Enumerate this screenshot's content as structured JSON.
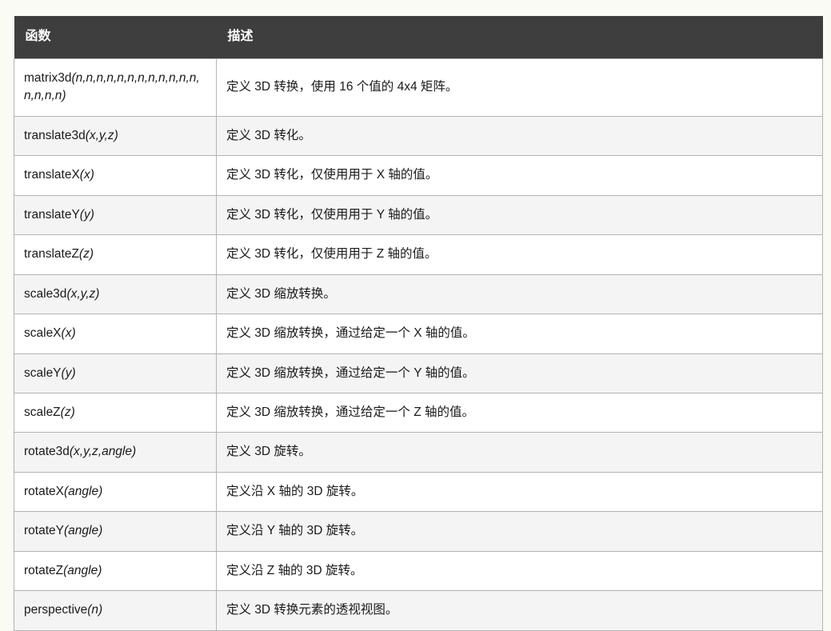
{
  "table": {
    "headers": {
      "function": "函数",
      "description": "描述"
    },
    "rows": [
      {
        "function_name": "matrix3d",
        "function_args": "(n,n,n,n,n,n,n,n,n,n,n,n,n,n,n,n)",
        "function_full": "matrix3d(n,n,n,n,n,n,n,n,n,n,n,n,n,n,n,n)",
        "description": "定义 3D 转换，使用 16 个值的 4x4 矩阵。"
      },
      {
        "function_name": "translate3d",
        "function_args": "(x,y,z)",
        "function_full": "translate3d(x,y,z)",
        "description": "定义 3D 转化。"
      },
      {
        "function_name": "translateX",
        "function_args": "(x)",
        "function_full": "translateX(x)",
        "description": "定义 3D 转化，仅使用用于 X 轴的值。"
      },
      {
        "function_name": "translateY",
        "function_args": "(y)",
        "function_full": "translateY(y)",
        "description": "定义 3D 转化，仅使用用于 Y 轴的值。"
      },
      {
        "function_name": "translateZ",
        "function_args": "(z)",
        "function_full": "translateZ(z)",
        "description": "定义 3D 转化，仅使用用于 Z 轴的值。"
      },
      {
        "function_name": "scale3d",
        "function_args": "(x,y,z)",
        "function_full": "scale3d(x,y,z)",
        "description": "定义 3D 缩放转换。"
      },
      {
        "function_name": "scaleX",
        "function_args": "(x)",
        "function_full": "scaleX(x)",
        "description": "定义 3D 缩放转换，通过给定一个 X 轴的值。"
      },
      {
        "function_name": "scaleY",
        "function_args": "(y)",
        "function_full": "scaleY(y)",
        "description": "定义 3D 缩放转换，通过给定一个 Y 轴的值。"
      },
      {
        "function_name": "scaleZ",
        "function_args": "(z)",
        "function_full": "scaleZ(z)",
        "description": "定义 3D 缩放转换，通过给定一个 Z 轴的值。"
      },
      {
        "function_name": "rotate3d",
        "function_args": "(x,y,z,angle)",
        "function_full": "rotate3d(x,y,z,angle)",
        "description": "定义 3D 旋转。"
      },
      {
        "function_name": "rotateX",
        "function_args": "(angle)",
        "function_full": "rotateX(angle)",
        "description": "定义沿 X 轴的 3D 旋转。"
      },
      {
        "function_name": "rotateY",
        "function_args": "(angle)",
        "function_full": "rotateY(angle)",
        "description": "定义沿 Y 轴的 3D 旋转。"
      },
      {
        "function_name": "rotateZ",
        "function_args": "(angle)",
        "function_full": "rotateZ(angle)",
        "description": "定义沿 Z 轴的 3D 旋转。"
      },
      {
        "function_name": "perspective",
        "function_args": "(n)",
        "function_full": "perspective(n)",
        "description": "定义 3D 转换元素的透视视图。"
      }
    ]
  },
  "colors": {
    "page_background": "#fbfbf6",
    "header_background": "#3e3e3e",
    "header_text": "#ffffff",
    "row_background": "#ffffff",
    "row_alt_background": "#f4f4f4",
    "border": "#b3b3b3",
    "body_text": "#1a1a1a"
  }
}
